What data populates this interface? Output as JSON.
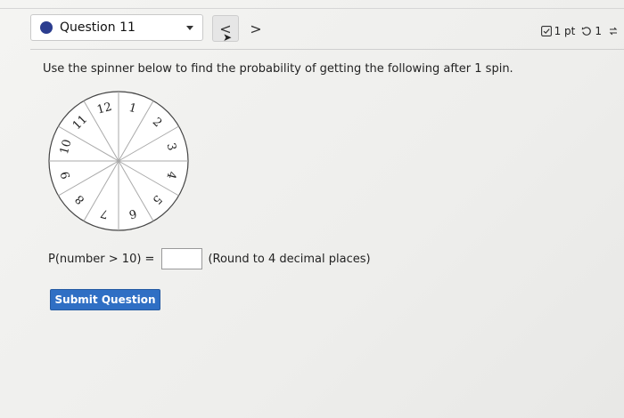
{
  "header": {
    "question_label": "Question 11",
    "prev_label": "<",
    "next_label": ">",
    "points": "1 pt",
    "retries": "1"
  },
  "question": {
    "prompt": "Use the spinner below to find the probability of getting the following after 1 spin.",
    "spinner_numbers": [
      "1",
      "2",
      "3",
      "4",
      "5",
      "6",
      "7",
      "8",
      "9",
      "10",
      "11",
      "12"
    ],
    "answer_label": "P(number > 10) =",
    "answer_value": "",
    "round_note": "(Round to 4 decimal places)"
  },
  "actions": {
    "submit_label": "Submit Question"
  },
  "colors": {
    "accent": "#2f6fc4",
    "dot": "#2b3d8f"
  }
}
